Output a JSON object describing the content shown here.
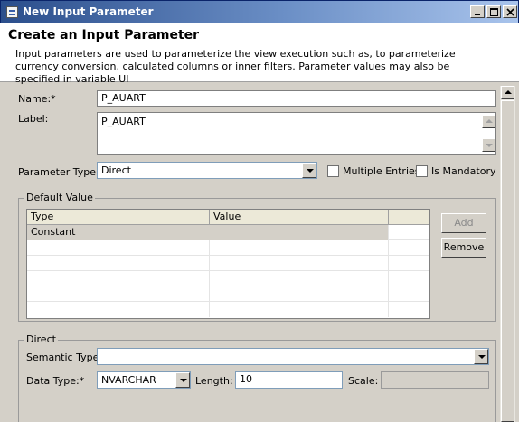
{
  "window": {
    "title": "New Input Parameter",
    "minimize": "minimize",
    "maximize": "maximize",
    "close": "close"
  },
  "header": {
    "title": "Create an Input Parameter",
    "description": "Input parameters are used to parameterize the view execution such as, to parameterize currency conversion, calculated columns or inner filters. Parameter values may also be specified in variable UI"
  },
  "form": {
    "name_label": "Name:*",
    "name_value": "P_AUART",
    "label_label": "Label:",
    "label_value": "P_AUART",
    "param_type_label": "Parameter Type:",
    "param_type_value": "Direct",
    "multiple_entries_label": "Multiple Entries",
    "multiple_entries_checked": false,
    "is_mandatory_label": "Is Mandatory",
    "is_mandatory_checked": false
  },
  "default_value": {
    "group_title": "Default Value",
    "columns": [
      "Type",
      "Value"
    ],
    "rows": [
      {
        "type": "Constant",
        "value": "",
        "selected": true
      }
    ],
    "add_label": "Add",
    "add_enabled": false,
    "remove_label": "Remove"
  },
  "direct": {
    "group_title": "Direct",
    "semantic_type_label": "Semantic Type:",
    "semantic_type_value": "",
    "data_type_label": "Data Type:*",
    "data_type_value": "NVARCHAR",
    "length_label": "Length:",
    "length_value": "10",
    "scale_label": "Scale:",
    "scale_value": ""
  },
  "colors": {
    "titlebar_start": "#2b4e8c",
    "titlebar_end": "#a9c4ec",
    "selected_row": "#d4d0c8"
  }
}
